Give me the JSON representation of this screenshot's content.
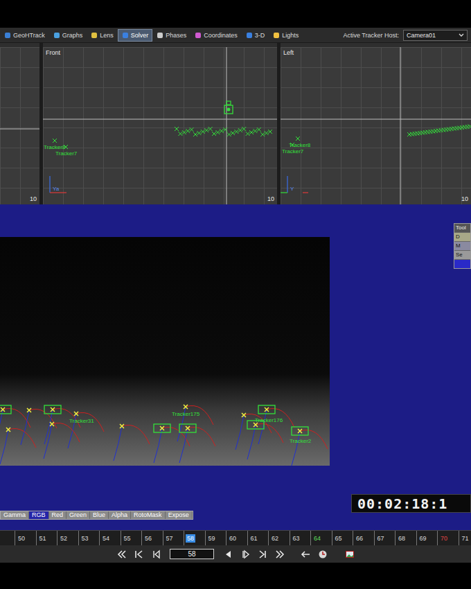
{
  "toolbar": {
    "tabs": [
      {
        "label": "GeoHTrack",
        "selected": false
      },
      {
        "label": "Graphs",
        "selected": false
      },
      {
        "label": "Lens",
        "selected": false
      },
      {
        "label": "Solver",
        "selected": true
      },
      {
        "label": "Phases",
        "selected": false
      },
      {
        "label": "Coordinates",
        "selected": false
      },
      {
        "label": "3-D",
        "selected": false
      },
      {
        "label": "Lights",
        "selected": false
      }
    ],
    "host_label": "Active Tracker Host:",
    "host_value": "Camera01"
  },
  "views": [
    {
      "title": "",
      "scale": "10",
      "labels": [],
      "axis": ""
    },
    {
      "title": "Front",
      "scale": "10",
      "labels": [
        "Tracker8",
        "Tracker7"
      ],
      "axis": "Ya"
    },
    {
      "title": "Left",
      "scale": "10",
      "labels": [
        "Tracker8",
        "Tracker7"
      ],
      "axis": "Y"
    }
  ],
  "trackers": [
    {
      "kind": "box"
    },
    {
      "kind": "x"
    },
    {
      "kind": "box"
    },
    {
      "kind": "x"
    },
    {
      "kind": "x"
    },
    {
      "kind": "x"
    },
    {
      "kind": "box"
    },
    {
      "kind": "x"
    },
    {
      "kind": "x"
    },
    {
      "kind": "x"
    },
    {
      "kind": "box"
    },
    {
      "kind": "box"
    },
    {
      "kind": "box"
    },
    {
      "kind": "box"
    }
  ],
  "tracker_labels": [
    "Tracker31",
    "Tracker175",
    "Tracker176",
    "Tracker2"
  ],
  "tool_panel": {
    "title": "Tool",
    "rows": [
      {
        "label": "D",
        "selected": false
      },
      {
        "label": "M",
        "selected": false
      },
      {
        "label": "Se",
        "selected": false
      },
      {
        "label": "",
        "selected": true
      }
    ]
  },
  "timecode": "00:02:18:1",
  "channels": [
    {
      "label": "Gamma",
      "selected": false
    },
    {
      "label": "RGB",
      "selected": true
    },
    {
      "label": "Red",
      "selected": false
    },
    {
      "label": "Green",
      "selected": false
    },
    {
      "label": "Blue",
      "selected": false
    },
    {
      "label": "Alpha",
      "selected": false
    },
    {
      "label": "RotoMask",
      "selected": false
    },
    {
      "label": "Expose",
      "selected": false
    }
  ],
  "timeline": [
    {
      "frame": "50",
      "selected": false,
      "color": "#dddddd"
    },
    {
      "frame": "51",
      "selected": false,
      "color": "#dddddd"
    },
    {
      "frame": "52",
      "selected": false,
      "color": "#dddddd"
    },
    {
      "frame": "53",
      "selected": false,
      "color": "#dddddd"
    },
    {
      "frame": "54",
      "selected": false,
      "color": "#dddddd"
    },
    {
      "frame": "55",
      "selected": false,
      "color": "#dddddd"
    },
    {
      "frame": "56",
      "selected": false,
      "color": "#dddddd"
    },
    {
      "frame": "57",
      "selected": false,
      "color": "#dddddd"
    },
    {
      "frame": "58",
      "selected": true,
      "color": "#ffffff"
    },
    {
      "frame": "59",
      "selected": false,
      "color": "#dddddd"
    },
    {
      "frame": "60",
      "selected": false,
      "color": "#dddddd"
    },
    {
      "frame": "61",
      "selected": false,
      "color": "#dddddd"
    },
    {
      "frame": "62",
      "selected": false,
      "color": "#dddddd"
    },
    {
      "frame": "63",
      "selected": false,
      "color": "#dddddd"
    },
    {
      "frame": "64",
      "selected": false,
      "color": "#5fdc5f"
    },
    {
      "frame": "65",
      "selected": false,
      "color": "#dddddd"
    },
    {
      "frame": "66",
      "selected": false,
      "color": "#dddddd"
    },
    {
      "frame": "67",
      "selected": false,
      "color": "#dddddd"
    },
    {
      "frame": "68",
      "selected": false,
      "color": "#dddddd"
    },
    {
      "frame": "69",
      "selected": false,
      "color": "#dddddd"
    },
    {
      "frame": "70",
      "selected": false,
      "color": "#e04545"
    },
    {
      "frame": "71",
      "selected": false,
      "color": "#dddddd"
    }
  ],
  "current_frame": "58"
}
